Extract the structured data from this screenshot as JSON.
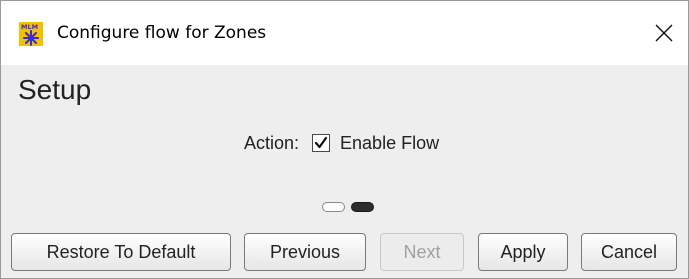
{
  "window": {
    "title": "Configure flow for Zones",
    "app_icon_text": "MLM",
    "app_icon": "mlm-app-icon",
    "close_icon": "close-icon"
  },
  "page": {
    "heading": "Setup"
  },
  "action": {
    "label": "Action:",
    "checkbox_label": "Enable Flow",
    "checked": true
  },
  "pagination": {
    "pages": 2,
    "current_page": 2
  },
  "buttons": {
    "restore_default": "Restore To Default",
    "previous": "Previous",
    "next": "Next",
    "next_enabled": false,
    "apply": "Apply",
    "cancel": "Cancel"
  },
  "colors": {
    "content_background": "#eeeeee",
    "titlebar_background": "#ffffff",
    "active_page_dot": "#2d2d2d",
    "app_icon_background": "#f2c200",
    "app_icon_star": "#3b2bd6"
  }
}
